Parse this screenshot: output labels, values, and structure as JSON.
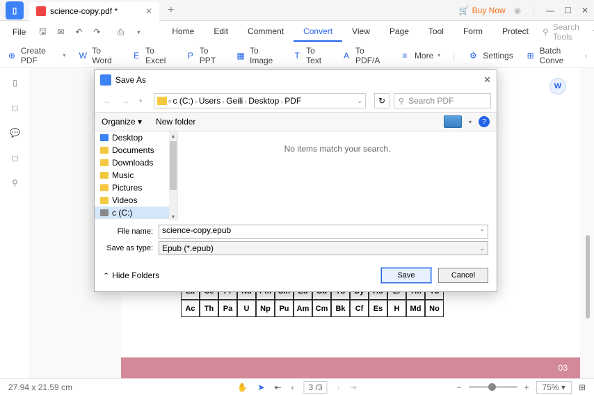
{
  "title_bar": {
    "tab_title": "science-copy.pdf *",
    "buy_now": "Buy Now"
  },
  "menu": {
    "file": "File",
    "nav": [
      "Home",
      "Edit",
      "Comment",
      "Convert",
      "View",
      "Page",
      "Tool",
      "Form",
      "Protect"
    ],
    "active_index": 3,
    "search_tools": "Search Tools"
  },
  "toolbar": {
    "create_pdf": "Create PDF",
    "to_word": "To Word",
    "to_excel": "To Excel",
    "to_ppt": "To PPT",
    "to_image": "To Image",
    "to_text": "To Text",
    "to_pdfa": "To PDF/A",
    "more": "More",
    "settings": "Settings",
    "batch_convert": "Batch Conve"
  },
  "dialog": {
    "title": "Save As",
    "breadcrumb": [
      "c (C:)",
      "Users",
      "Geili",
      "Desktop",
      "PDF"
    ],
    "search_placeholder": "Search PDF",
    "organize": "Organize",
    "new_folder": "New folder",
    "tree": [
      {
        "label": "Desktop",
        "icon": "desktop"
      },
      {
        "label": "Documents",
        "icon": "folder"
      },
      {
        "label": "Downloads",
        "icon": "folder"
      },
      {
        "label": "Music",
        "icon": "folder"
      },
      {
        "label": "Pictures",
        "icon": "folder"
      },
      {
        "label": "Videos",
        "icon": "folder"
      },
      {
        "label": "c (C:)",
        "icon": "disk",
        "selected": true
      }
    ],
    "empty_msg": "No items match your search.",
    "file_name_label": "File name:",
    "file_name_value": "science-copy.epub",
    "save_type_label": "Save as type:",
    "save_type_value": "Epub (*.epub)",
    "hide_folders": "Hide Folders",
    "save": "Save",
    "cancel": "Cancel"
  },
  "document": {
    "periodic_rows": [
      [
        "La",
        "Ce",
        "Pr",
        "Nd",
        "Pm",
        "Sm",
        "Eu",
        "Gd",
        "Tb",
        "Dy",
        "Ho",
        "Er",
        "Tm",
        "Yb"
      ],
      [
        "Ac",
        "Th",
        "Pa",
        "U",
        "Np",
        "Pu",
        "Am",
        "Cm",
        "Bk",
        "Cf",
        "Es",
        "H",
        "Md",
        "No"
      ]
    ],
    "page_badge": "03",
    "float_badge": "W"
  },
  "status": {
    "dimensions": "27.94 x 21.59 cm",
    "page_current": "3",
    "page_total": "/3",
    "zoom": "75%"
  }
}
